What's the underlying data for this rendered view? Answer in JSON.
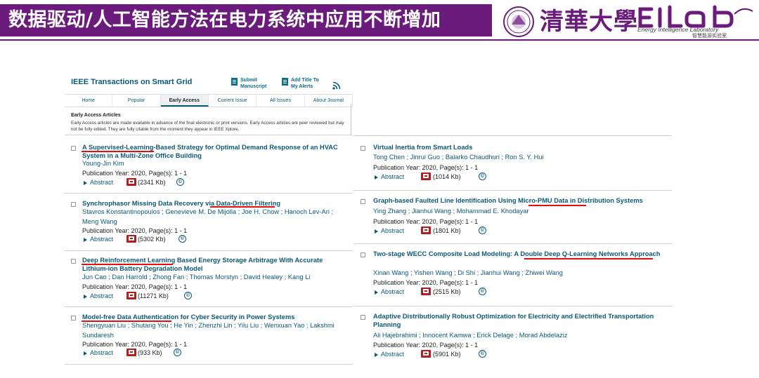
{
  "banner": {
    "title": "数据驱动/人工智能方法在电力系统中应用不断增加",
    "university_logo_text": "清華大學",
    "lab_logo_text": "EIlab",
    "lab_name_en": "Energy Intelligence Laboratory",
    "lab_name_cn": "智慧能源实验室",
    "colors": {
      "brand": "#6a1b7c",
      "link": "#0a5a78",
      "underline": "#dd1111"
    }
  },
  "ieee": {
    "journal_title": "IEEE Transactions on Smart Grid",
    "submit_label": "Submit Manuscript",
    "alert_label": "Add Title To My Alerts",
    "rss_icon": "rss-icon",
    "tabs": [
      {
        "label": "Home"
      },
      {
        "label": "Popular"
      },
      {
        "label": "Early Access",
        "active": true
      },
      {
        "label": "Current Issue"
      },
      {
        "label": "All Issues"
      },
      {
        "label": "About Journal"
      }
    ],
    "early_access_heading": "Early Access Articles",
    "early_access_text": "Early Access articles are made available in advance of the final electronic or print versions. Early Access articles are peer reviewed but may not be fully edited. They are fully citable from the moment they appear in IEEE Xplore."
  },
  "articles": [
    {
      "title": "A Supervised-Learning-Based Strategy for Optimal Demand Response of an HVAC System in a Multi-Zone Office Building",
      "authors": "Young-Jin Kim",
      "meta": "Publication Year: 2020, Page(s): 1 - 1",
      "abstract": "Abstract",
      "size": "(2341 Kb)"
    },
    {
      "title": "Synchrophasor Missing Data Recovery via Data-Driven Filtering",
      "authors": "Stavros Konstantinopoulos ; Genevieve M. De Mijolla ; Joe H. Chow ; Hanoch Lev-Ari ; Meng Wang",
      "meta": "Publication Year: 2020, Page(s): 1 - 1",
      "abstract": "Abstract",
      "size": "(5302 Kb)"
    },
    {
      "title": "Deep Reinforcement Learning Based Energy Storage Arbitrage With Accurate Lithium-ion Battery Degradation Model",
      "authors": "Jun Cao ; Dan Harrold ; Zhong Fan ; Thomas Morstyn ; David Healey ; Kang Li",
      "meta": "Publication Year: 2020, Page(s): 1 - 1",
      "abstract": "Abstract",
      "size": "(11271 Kb)"
    },
    {
      "title": "Model-free Data Authentication for Cyber Security in Power Systems",
      "authors": "Shengyuan Liu ; Shutang You ; He Yin ; Zhenzhi Lin ; Yilu Liu ; Wenxuan Yao ; Lakshmi Sundaresh",
      "meta": "Publication Year: 2020, Page(s): 1 - 1",
      "abstract": "Abstract",
      "size": "(933 Kb)"
    },
    {
      "title": "Virtual Inertia from Smart Loads",
      "authors": "Tong Chen ; Jinrui Guo ; Balarko Chaudhuri ; Ron S. Y. Hui",
      "meta": "Publication Year: 2020, Page(s): 1 - 1",
      "abstract": "Abstract",
      "size": "(1014 Kb)"
    },
    {
      "title": "Graph-based Faulted Line Identification Using Micro-PMU Data in Distribution Systems",
      "authors": "Ying Zhang ; Jianhui Wang ; Mohammad E. Khodayar",
      "meta": "Publication Year: 2020, Page(s): 1 - 1",
      "abstract": "Abstract",
      "size": "(1801 Kb)"
    },
    {
      "title": "Two-stage WECC Composite Load Modeling: A Double Deep Q-Learning Networks Approach",
      "authors": "Xinan Wang ; Yishen Wang ; Di Shi ; Jianhui Wang ; Zhiwei Wang",
      "meta": "Publication Year: 2020, Page(s): 1 - 1",
      "abstract": "Abstract",
      "size": "(2515 Kb)"
    },
    {
      "title": "Adaptive Distributionally Robust Optimization for Electricity and Electrified Transportation Planning",
      "authors": "Ali Hajebrahimi ; Innocent Kamwa ; Erick Delage ; Morad Abdelaziz",
      "meta": "Publication Year: 2020, Page(s): 1 - 1",
      "abstract": "Abstract",
      "size": "(5901 Kb)"
    }
  ]
}
